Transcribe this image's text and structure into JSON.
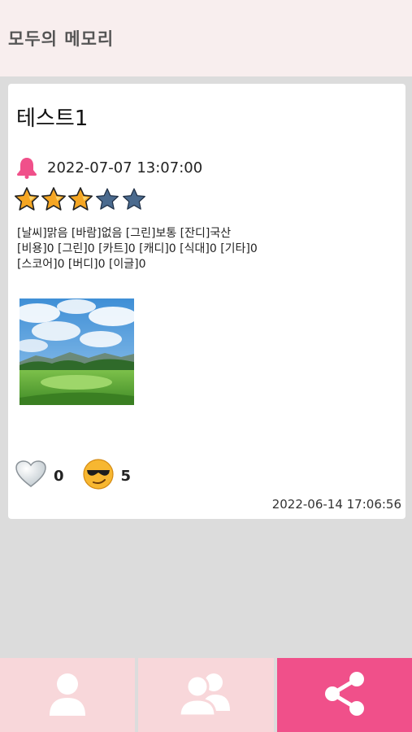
{
  "header": {
    "title": "모두의 메모리"
  },
  "memo": {
    "title": "테스트1",
    "alarm_time": "2022-07-07 13:07:00",
    "rating": 3,
    "rating_max": 5,
    "info_lines": [
      "[날씨]맑음 [바람]없음 [그린]보통 [잔디]국산",
      "[비용]0 [그린]0 [카트]0 [캐디]0 [식대]0 [기타]0",
      "[스코어]0 [버디]0 [이글]0"
    ],
    "like_count": "0",
    "cool_count": "5",
    "created_at": "2022-06-14 17:06:56"
  },
  "nav": [
    {
      "icon": "user-icon",
      "active": false
    },
    {
      "icon": "users-icon",
      "active": false
    },
    {
      "icon": "share-icon",
      "active": true
    }
  ],
  "colors": {
    "header_bg": "#f8eeee",
    "nav_bg": "#f8d7da",
    "nav_active": "#f0508a",
    "bell": "#f0508a",
    "star_filled": "#f5a623",
    "star_empty": "#4a6a8e"
  }
}
